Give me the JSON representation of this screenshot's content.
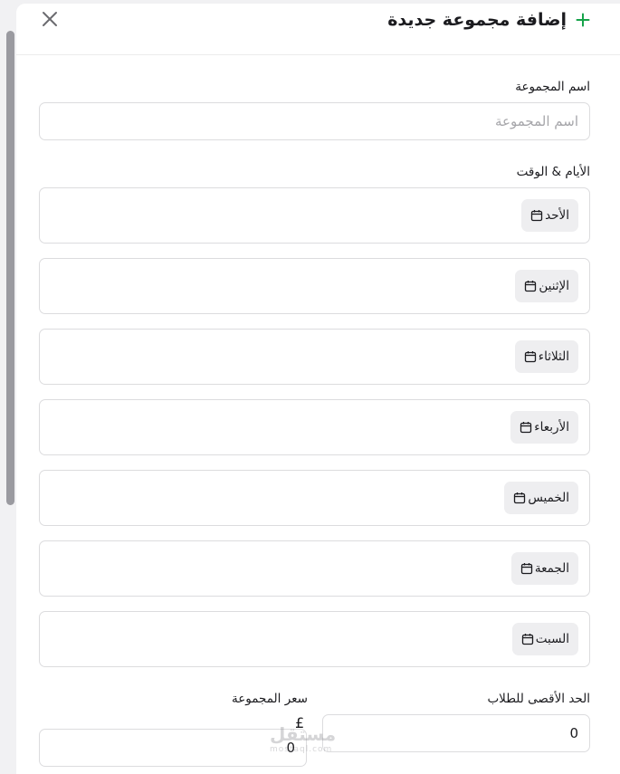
{
  "header": {
    "title": "إضافة مجموعة جديدة",
    "close_icon": "close-icon",
    "plus_icon": "plus-icon",
    "accent_color": "#16a34a"
  },
  "group_name": {
    "label": "اسم المجموعة",
    "placeholder": "اسم المجموعة",
    "value": ""
  },
  "schedule": {
    "label": "الأيام & الوقت",
    "days": [
      {
        "label": "الأحد"
      },
      {
        "label": "الإثنين"
      },
      {
        "label": "الثلاثاء"
      },
      {
        "label": "الأربعاء"
      },
      {
        "label": "الخميس"
      },
      {
        "label": "الجمعة"
      },
      {
        "label": "السبت"
      }
    ],
    "day_icon": "calendar-icon"
  },
  "max_students": {
    "label": "الحد الأقصى للطلاب",
    "value": "0"
  },
  "group_price": {
    "label": "سعر المجموعة",
    "currency": "£",
    "value": "0"
  },
  "watermark": {
    "text": "مستقل",
    "subtext": "mostaql.com"
  }
}
